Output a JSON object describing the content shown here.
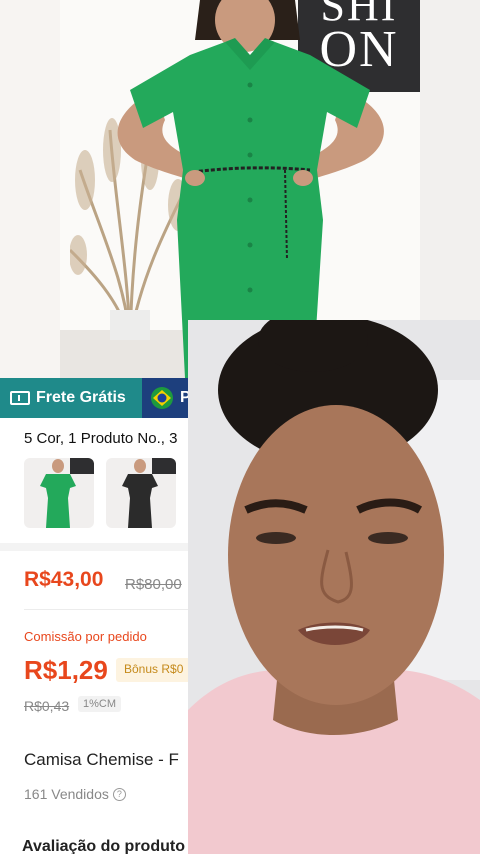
{
  "hero": {
    "brand_sign_line1": "SHI",
    "brand_sign_line2": "ON"
  },
  "badges": {
    "frete_label": "Frete Grátis",
    "flag_label": "P",
    "flag_icon": "brazil-flag-icon"
  },
  "product": {
    "variants_text": "5 Cor, 1 Produto No., 3",
    "thumbnails": [
      {
        "color": "green"
      },
      {
        "color": "black"
      },
      {
        "color": "partial"
      }
    ],
    "price": "R$43,00",
    "old_price": "R$80,00",
    "comissao_label": "Comissão por pedido",
    "comissao_value": "R$1,29",
    "bonus_text": "Bônus R$0",
    "comissao_old": "R$0,43",
    "cm_badge": "1%CM",
    "title": "Camisa Chemise - F",
    "sold": "161 Vendidos",
    "avaliacao": "Avaliação do produto"
  },
  "colors": {
    "accent_orange": "#e8471d",
    "frete_teal": "#1f8a8a",
    "flag_blue": "#1d3f7d",
    "dress_green": "#23a95b"
  }
}
